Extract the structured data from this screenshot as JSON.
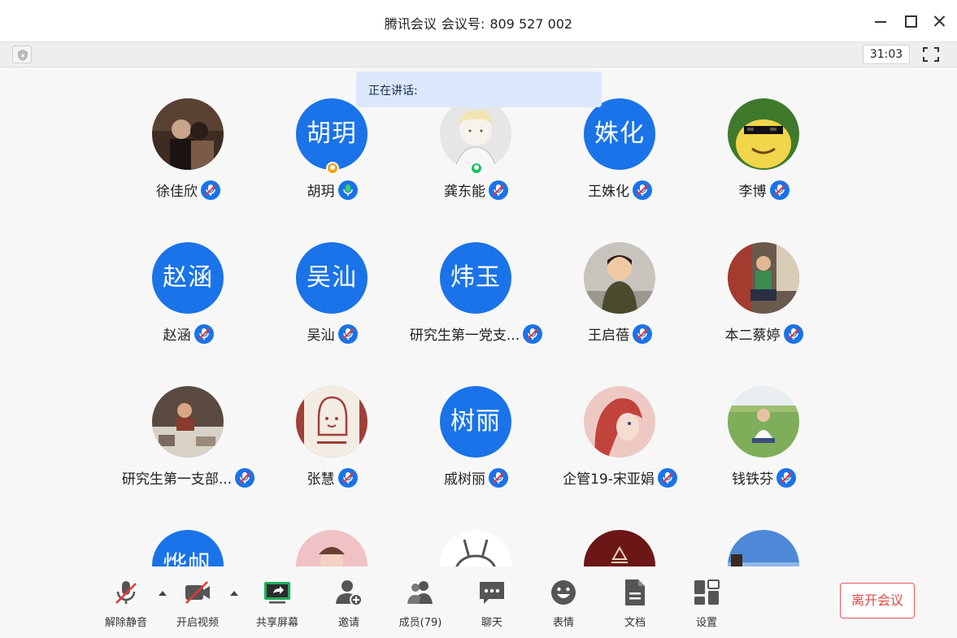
{
  "titlebar": {
    "app_name": "腾讯会议",
    "meeting_label": "会议号:",
    "meeting_number": "809 527 002"
  },
  "infobar": {
    "timer": "31:03"
  },
  "speaking": {
    "label": "正在讲话:"
  },
  "participants": [
    {
      "name": "徐佳欣",
      "avatar_type": "photo",
      "mic": "muted"
    },
    {
      "name": "胡玥",
      "avatar_type": "text",
      "avatar_text": "胡玥",
      "badge": "orange",
      "mic": "active"
    },
    {
      "name": "龚东能",
      "avatar_type": "photo",
      "badge": "green",
      "mic": "muted"
    },
    {
      "name": "王姝化",
      "avatar_type": "text",
      "avatar_text": "姝化",
      "mic": "muted"
    },
    {
      "name": "李博",
      "avatar_type": "photo",
      "mic": "muted"
    },
    {
      "name": "赵涵",
      "avatar_type": "text",
      "avatar_text": "赵涵",
      "mic": "muted"
    },
    {
      "name": "吴汕",
      "avatar_type": "text",
      "avatar_text": "吴汕",
      "mic": "muted"
    },
    {
      "name": "研究生第一党支...",
      "avatar_type": "text",
      "avatar_text": "炜玉",
      "mic": "muted"
    },
    {
      "name": "王启蓓",
      "avatar_type": "photo",
      "mic": "muted"
    },
    {
      "name": "本二蔡婷",
      "avatar_type": "photo",
      "mic": "muted"
    },
    {
      "name": "研究生第一支部...",
      "avatar_type": "photo",
      "mic": "muted"
    },
    {
      "name": "张慧",
      "avatar_type": "photo",
      "mic": "muted"
    },
    {
      "name": "戚树丽",
      "avatar_type": "text",
      "avatar_text": "树丽",
      "mic": "muted"
    },
    {
      "name": "企管19-宋亚娟",
      "avatar_type": "photo",
      "mic": "muted"
    },
    {
      "name": "钱铁芬",
      "avatar_type": "photo",
      "mic": "muted"
    },
    {
      "name": "",
      "avatar_type": "text",
      "avatar_text": "烨帆"
    },
    {
      "name": "",
      "avatar_type": "photo"
    },
    {
      "name": "",
      "avatar_type": "photo"
    },
    {
      "name": "",
      "avatar_type": "photo"
    },
    {
      "name": "",
      "avatar_type": "photo"
    }
  ],
  "toolbar": {
    "unmute": "解除静音",
    "start_video": "开启视频",
    "share_screen": "共享屏幕",
    "invite": "邀请",
    "members": "成员(79)",
    "chat": "聊天",
    "emoji": "表情",
    "docs": "文档",
    "settings": "设置",
    "leave": "离开会议"
  },
  "colors": {
    "avatar_blue": "#1a73e8",
    "leave_red": "#e24848",
    "share_green": "#1fb05a",
    "speaking_bg": "#dbe8fb"
  }
}
